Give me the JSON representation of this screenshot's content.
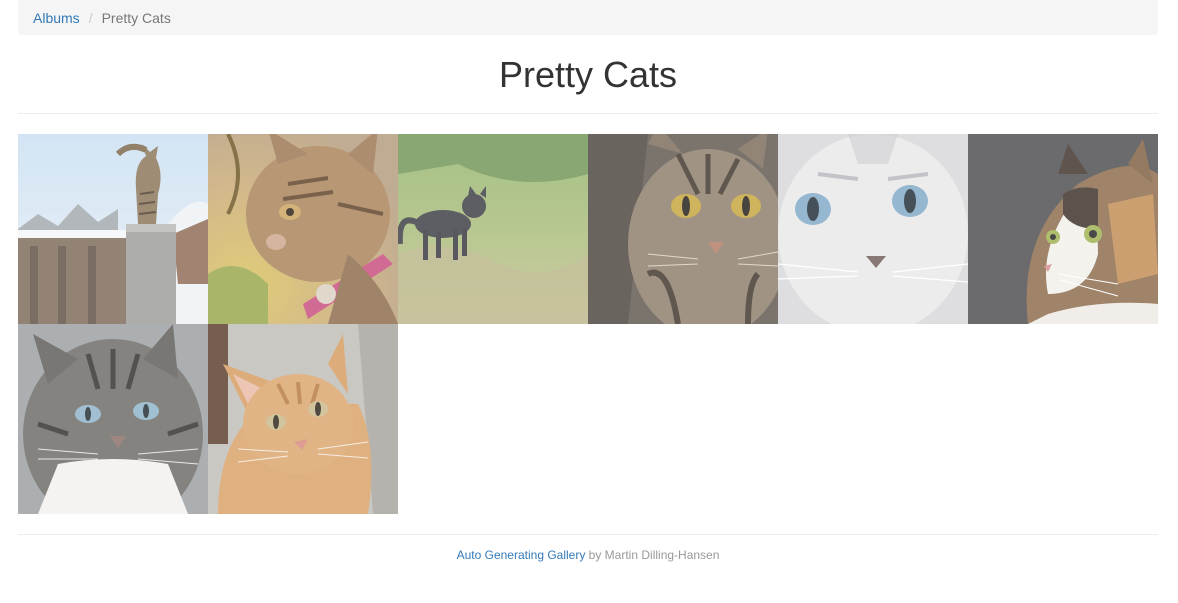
{
  "breadcrumb": {
    "albums_label": "Albums",
    "separator": "/",
    "current_label": "Pretty Cats"
  },
  "page": {
    "title": "Pretty Cats"
  },
  "gallery": {
    "photos": [
      {
        "subject": "tabby cat standing on snowy stone post"
      },
      {
        "subject": "tabby kitten with pink collar"
      },
      {
        "subject": "dark cat walking on grass"
      },
      {
        "subject": "tabby cat close-up with yellow eyes"
      },
      {
        "subject": "white kitten with blue eyes"
      },
      {
        "subject": "calico cat looking up"
      },
      {
        "subject": "grey tabby cat with blue eyes"
      },
      {
        "subject": "ginger cat portrait"
      }
    ]
  },
  "footer": {
    "link_label": "Auto Generating Gallery",
    "by_text": " by Martin Dilling-Hansen"
  },
  "colors": {
    "link": "#337ab7",
    "breadcrumb_bg": "#f5f5f5",
    "muted": "#777777",
    "divider": "#eeeeee"
  }
}
